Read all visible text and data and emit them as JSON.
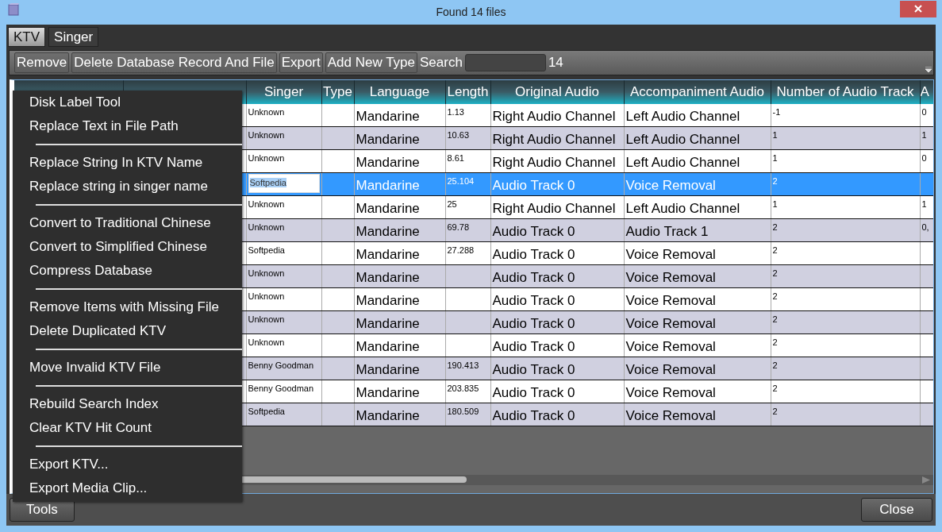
{
  "window": {
    "title": "Found 14 files"
  },
  "tabs": [
    {
      "label": "KTV",
      "selected": true
    },
    {
      "label": "Singer",
      "selected": false
    }
  ],
  "toolbar": {
    "buttons": [
      "Remove",
      "Delete Database Record And File",
      "Export",
      "Add New Type"
    ],
    "search_label": "Search",
    "result_count": "14"
  },
  "table": {
    "columns": [
      "Singer",
      "Type",
      "Language",
      "Length",
      "Original Audio",
      "Accompaniment Audio",
      "Number of Audio Track",
      "A"
    ],
    "rows": [
      {
        "selected": false,
        "singer": "Unknown",
        "language": "Mandarine",
        "length": "1.13",
        "original_audio": "Right Audio Channel",
        "accompaniment_audio": "Left Audio Channel",
        "audio_tracks": "-1",
        "column_10": "0"
      },
      {
        "selected": false,
        "singer": "Unknown",
        "language": "Mandarine",
        "length": "10.63",
        "original_audio": "Right Audio Channel",
        "accompaniment_audio": "Left Audio Channel",
        "audio_tracks": "1",
        "column_10": "1"
      },
      {
        "selected": false,
        "singer": "Unknown",
        "language": "Mandarine",
        "length": "8.61",
        "original_audio": "Right Audio Channel",
        "accompaniment_audio": "Left Audio Channel",
        "audio_tracks": "1",
        "column_10": "0"
      },
      {
        "selected": true,
        "singer": "Softpedia",
        "language": "Mandarine",
        "length": "25.104",
        "original_audio": "Audio Track 0",
        "accompaniment_audio": "Voice Removal",
        "audio_tracks": "2"
      },
      {
        "selected": false,
        "singer": "Unknown",
        "language": "Mandarine",
        "length": "25",
        "original_audio": "Right Audio Channel",
        "accompaniment_audio": "Left Audio Channel",
        "audio_tracks": "1",
        "column_10": "1"
      },
      {
        "selected": false,
        "singer": "Unknown",
        "language": "Mandarine",
        "length": "69.78",
        "original_audio": "Audio Track 0",
        "accompaniment_audio": "Audio Track 1",
        "audio_tracks": "2",
        "column_10": "0,"
      },
      {
        "selected": false,
        "singer": "Softpedia",
        "language": "Mandarine",
        "length": "27.288",
        "original_audio": "Audio Track 0",
        "accompaniment_audio": "Voice Removal",
        "audio_tracks": "2"
      },
      {
        "selected": false,
        "singer": "Unknown",
        "language": "Mandarine",
        "original_audio": "Audio Track 0",
        "accompaniment_audio": "Voice Removal",
        "audio_tracks": "2"
      },
      {
        "selected": false,
        "singer": "Unknown",
        "language": "Mandarine",
        "original_audio": "Audio Track 0",
        "accompaniment_audio": "Voice Removal",
        "audio_tracks": "2"
      },
      {
        "selected": false,
        "singer": "Unknown",
        "language": "Mandarine",
        "original_audio": "Audio Track 0",
        "accompaniment_audio": "Voice Removal",
        "audio_tracks": "2"
      },
      {
        "selected": false,
        "singer": "Unknown",
        "language": "Mandarine",
        "original_audio": "Audio Track 0",
        "accompaniment_audio": "Voice Removal",
        "audio_tracks": "2"
      },
      {
        "selected": false,
        "singer": "Benny Goodman",
        "language": "Mandarine",
        "length": "190.413",
        "original_audio": "Audio Track 0",
        "accompaniment_audio": "Voice Removal",
        "audio_tracks": "2"
      },
      {
        "selected": false,
        "singer": "Benny Goodman",
        "language": "Mandarine",
        "length": "203.835",
        "original_audio": "Audio Track 0",
        "accompaniment_audio": "Voice Removal",
        "audio_tracks": "2"
      },
      {
        "selected": false,
        "singer": "Softpedia",
        "language": "Mandarine",
        "length": "180.509",
        "original_audio": "Audio Track 0",
        "accompaniment_audio": "Voice Removal",
        "audio_tracks": "2"
      }
    ]
  },
  "context_menu": [
    {
      "kind": "item",
      "label": "Disk Label Tool"
    },
    {
      "kind": "item",
      "label": "Replace Text in File Path"
    },
    {
      "kind": "separator"
    },
    {
      "kind": "item",
      "label": "Replace String In KTV Name"
    },
    {
      "kind": "item",
      "label": "Replace string in singer name"
    },
    {
      "kind": "separator"
    },
    {
      "kind": "item",
      "label": "Convert to Traditional Chinese"
    },
    {
      "kind": "item",
      "label": "Convert to Simplified Chinese"
    },
    {
      "kind": "item",
      "label": "Compress Database"
    },
    {
      "kind": "separator"
    },
    {
      "kind": "item",
      "label": "Remove Items with Missing File"
    },
    {
      "kind": "item",
      "label": "Delete Duplicated KTV"
    },
    {
      "kind": "separator"
    },
    {
      "kind": "item",
      "label": "Move Invalid KTV File"
    },
    {
      "kind": "separator"
    },
    {
      "kind": "item",
      "label": "Rebuild Search Index"
    },
    {
      "kind": "item",
      "label": "Clear KTV Hit Count"
    },
    {
      "kind": "separator"
    },
    {
      "kind": "item",
      "label": "Export KTV..."
    },
    {
      "kind": "item",
      "label": "Export Media Clip..."
    }
  ],
  "footer": {
    "tools_button": "Tools",
    "close_button": "Close"
  }
}
